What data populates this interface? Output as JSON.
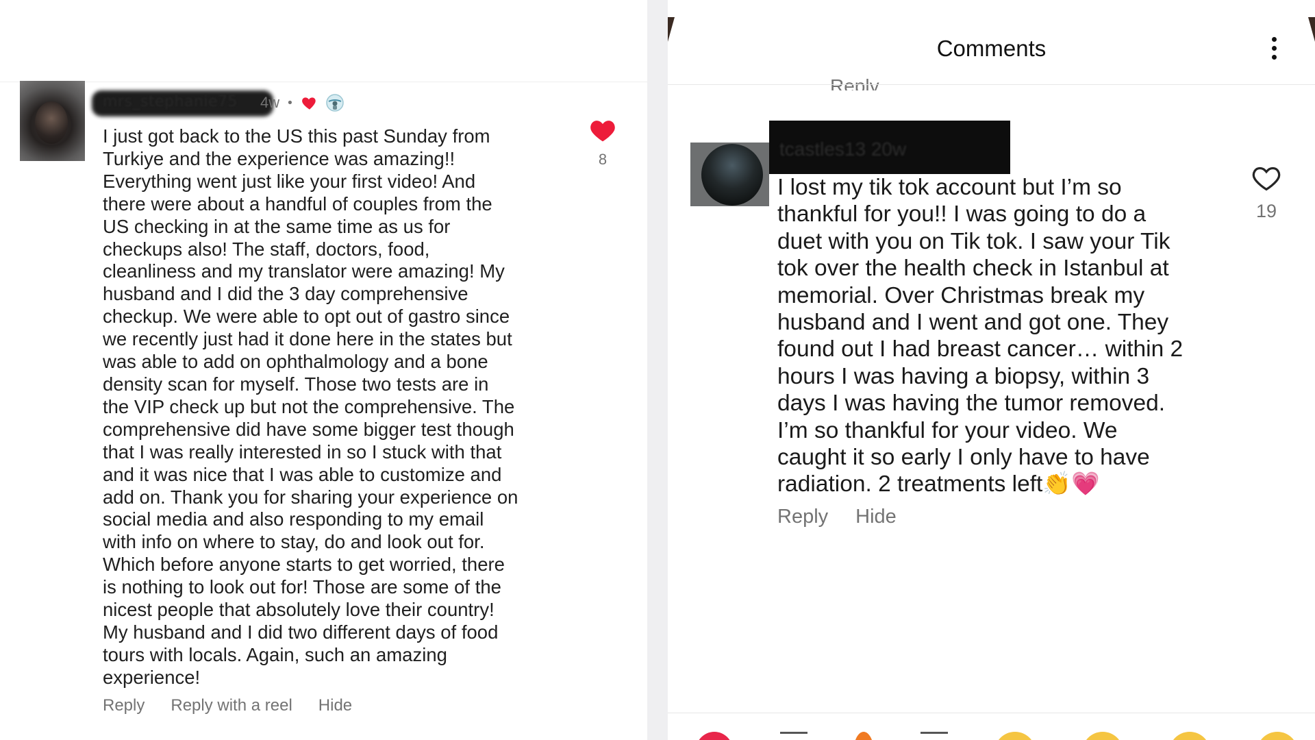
{
  "left_comment": {
    "username": "mrs_stephanie75",
    "time": "4w",
    "separator": "•",
    "text": "I just got back to the US this past Sunday from\nTurkiye and the experience was amazing!!\nEverything went just like your first video! And\nthere were about a handful of couples from the\nUS checking in at the same time as us for\ncheckups also! The staff, doctors, food,\ncleanliness and my translator were amazing! My\nhusband and I did the 3 day comprehensive\ncheckup. We were able to opt out of gastro since\nwe recently just had it done here in the states but\nwas able to add on ophthalmology and a bone\ndensity scan for myself. Those two tests are in\nthe VIP check up but not the comprehensive. The\ncomprehensive did have some bigger test though\nthat I was really interested in so I stuck with that\nand it was nice that I was able to customize and\nadd on. Thank you for sharing your experience on\nsocial media and also responding to my email\nwith info on where to stay, do and look out for.\nWhich before anyone starts to get worried, there\nis nothing to look out for! Those are some of the\nnicest people that absolutely love their country!\nMy husband and I did two different days of food\ntours with locals. Again, such an amazing\nexperience!",
    "like_count": "8",
    "like_icon": "heart-filled-icon",
    "like_color": "#ed1c3a",
    "actions": {
      "reply": "Reply",
      "reply_with_reel": "Reply with a reel",
      "hide": "Hide"
    }
  },
  "right_panel": {
    "header_title": "Comments",
    "menu_icon": "more-vertical-icon",
    "prev_reply": "Reply",
    "comment": {
      "username": "tcastles13",
      "time": "20w",
      "text": "I lost my tik tok account but I’m so\nthankful for you!! I was going to do a\nduet with you on Tik tok. I saw your Tik\ntok over the health check in Istanbul at\nmemorial. Over Christmas break my\nhusband and I went and got one. They\nfound out I had breast cancer… within 2\nhours I was having a biopsy, within 3\ndays I was having the tumor removed.\nI’m so thankful for your video. We\ncaught it so early I only have to have\nradiation. 2 treatments left👏💗",
      "like_count": "19",
      "like_icon": "heart-outline-icon",
      "actions": {
        "reply": "Reply",
        "hide": "Hide"
      }
    }
  }
}
